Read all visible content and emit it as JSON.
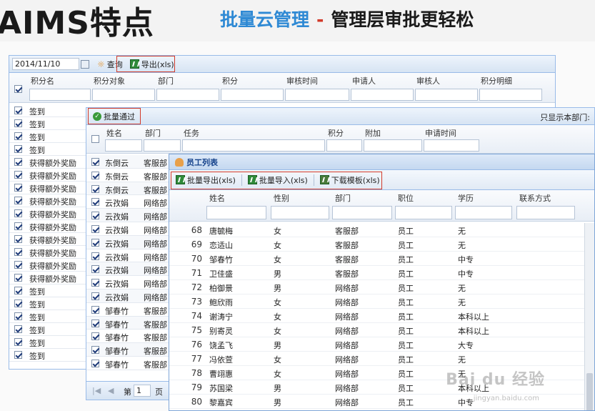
{
  "header": {
    "title": "AIMS特点",
    "subtitle_a": "批量云管理",
    "dash": "-",
    "subtitle_b": "管理层审批更轻松"
  },
  "win1": {
    "date": "2014/11/10",
    "query_label": "查询",
    "export_label": "导出(xls)",
    "columns": [
      "积分名",
      "积分对象",
      "部门",
      "积分",
      "审核时间",
      "申请人",
      "审核人",
      "积分明细"
    ],
    "rows": [
      "签到",
      "签到",
      "签到",
      "签到",
      "获得额外奖励",
      "获得额外奖励",
      "获得额外奖励",
      "获得额外奖励",
      "获得额外奖励",
      "获得额外奖励",
      "获得额外奖励",
      "获得额外奖励",
      "获得额外奖励",
      "获得额外奖励",
      "签到",
      "签到",
      "签到",
      "签到",
      "签到",
      "签到"
    ]
  },
  "win2": {
    "approve_label": "批量通过",
    "filter_label": "只显示本部门:",
    "columns": [
      "姓名",
      "部门",
      "任务",
      "积分",
      "附加",
      "申请时间"
    ],
    "rows": [
      {
        "name": "东倒云",
        "dept": "客服部"
      },
      {
        "name": "东倒云",
        "dept": "客服部"
      },
      {
        "name": "东倒云",
        "dept": "客服部"
      },
      {
        "name": "云孜娟",
        "dept": "网络部"
      },
      {
        "name": "云孜娟",
        "dept": "网络部"
      },
      {
        "name": "云孜娟",
        "dept": "网络部"
      },
      {
        "name": "云孜娟",
        "dept": "网络部"
      },
      {
        "name": "云孜娟",
        "dept": "网络部"
      },
      {
        "name": "云孜娟",
        "dept": "网络部"
      },
      {
        "name": "云孜娟",
        "dept": "网络部"
      },
      {
        "name": "云孜娟",
        "dept": "网络部"
      },
      {
        "name": "邹春竹",
        "dept": "客服部"
      },
      {
        "name": "邹春竹",
        "dept": "客服部"
      },
      {
        "name": "邹春竹",
        "dept": "客服部"
      },
      {
        "name": "邹春竹",
        "dept": "客服部"
      },
      {
        "name": "邹春竹",
        "dept": "客服部"
      }
    ],
    "pager_label": "第",
    "page": "1",
    "page_suffix": "页"
  },
  "win3": {
    "title": "员工列表",
    "btn_export": "批量导出(xls)",
    "btn_import": "批量导入(xls)",
    "btn_template": "下载模板(xls)",
    "columns": [
      "姓名",
      "性别",
      "部门",
      "职位",
      "学历",
      "联系方式"
    ],
    "rows": [
      {
        "no": "68",
        "name": "唐毓梅",
        "sex": "女",
        "dept": "客服部",
        "pos": "员工",
        "edu": "无"
      },
      {
        "no": "69",
        "name": "恋适山",
        "sex": "女",
        "dept": "客服部",
        "pos": "员工",
        "edu": "无"
      },
      {
        "no": "70",
        "name": "邹春竹",
        "sex": "女",
        "dept": "客服部",
        "pos": "员工",
        "edu": "中专"
      },
      {
        "no": "71",
        "name": "卫佳盛",
        "sex": "男",
        "dept": "客服部",
        "pos": "员工",
        "edu": "中专"
      },
      {
        "no": "72",
        "name": "柏御景",
        "sex": "男",
        "dept": "网络部",
        "pos": "员工",
        "edu": "无"
      },
      {
        "no": "73",
        "name": "鲍欣雨",
        "sex": "女",
        "dept": "网络部",
        "pos": "员工",
        "edu": "无"
      },
      {
        "no": "74",
        "name": "谢涛宁",
        "sex": "女",
        "dept": "网络部",
        "pos": "员工",
        "edu": "本科以上"
      },
      {
        "no": "75",
        "name": "别寄灵",
        "sex": "女",
        "dept": "网络部",
        "pos": "员工",
        "edu": "本科以上"
      },
      {
        "no": "76",
        "name": "饶孟飞",
        "sex": "男",
        "dept": "网络部",
        "pos": "员工",
        "edu": "大专"
      },
      {
        "no": "77",
        "name": "冯依萱",
        "sex": "女",
        "dept": "网络部",
        "pos": "员工",
        "edu": "无"
      },
      {
        "no": "78",
        "name": "曹翊惠",
        "sex": "女",
        "dept": "网络部",
        "pos": "员工",
        "edu": "无"
      },
      {
        "no": "79",
        "name": "苏国梁",
        "sex": "男",
        "dept": "网络部",
        "pos": "员工",
        "edu": "本科以上"
      },
      {
        "no": "80",
        "name": "黎嘉宾",
        "sex": "男",
        "dept": "网络部",
        "pos": "员工",
        "edu": "中专"
      }
    ]
  },
  "watermark": {
    "brand": "Bai du 经验",
    "url": "jingyan.baidu.com"
  }
}
